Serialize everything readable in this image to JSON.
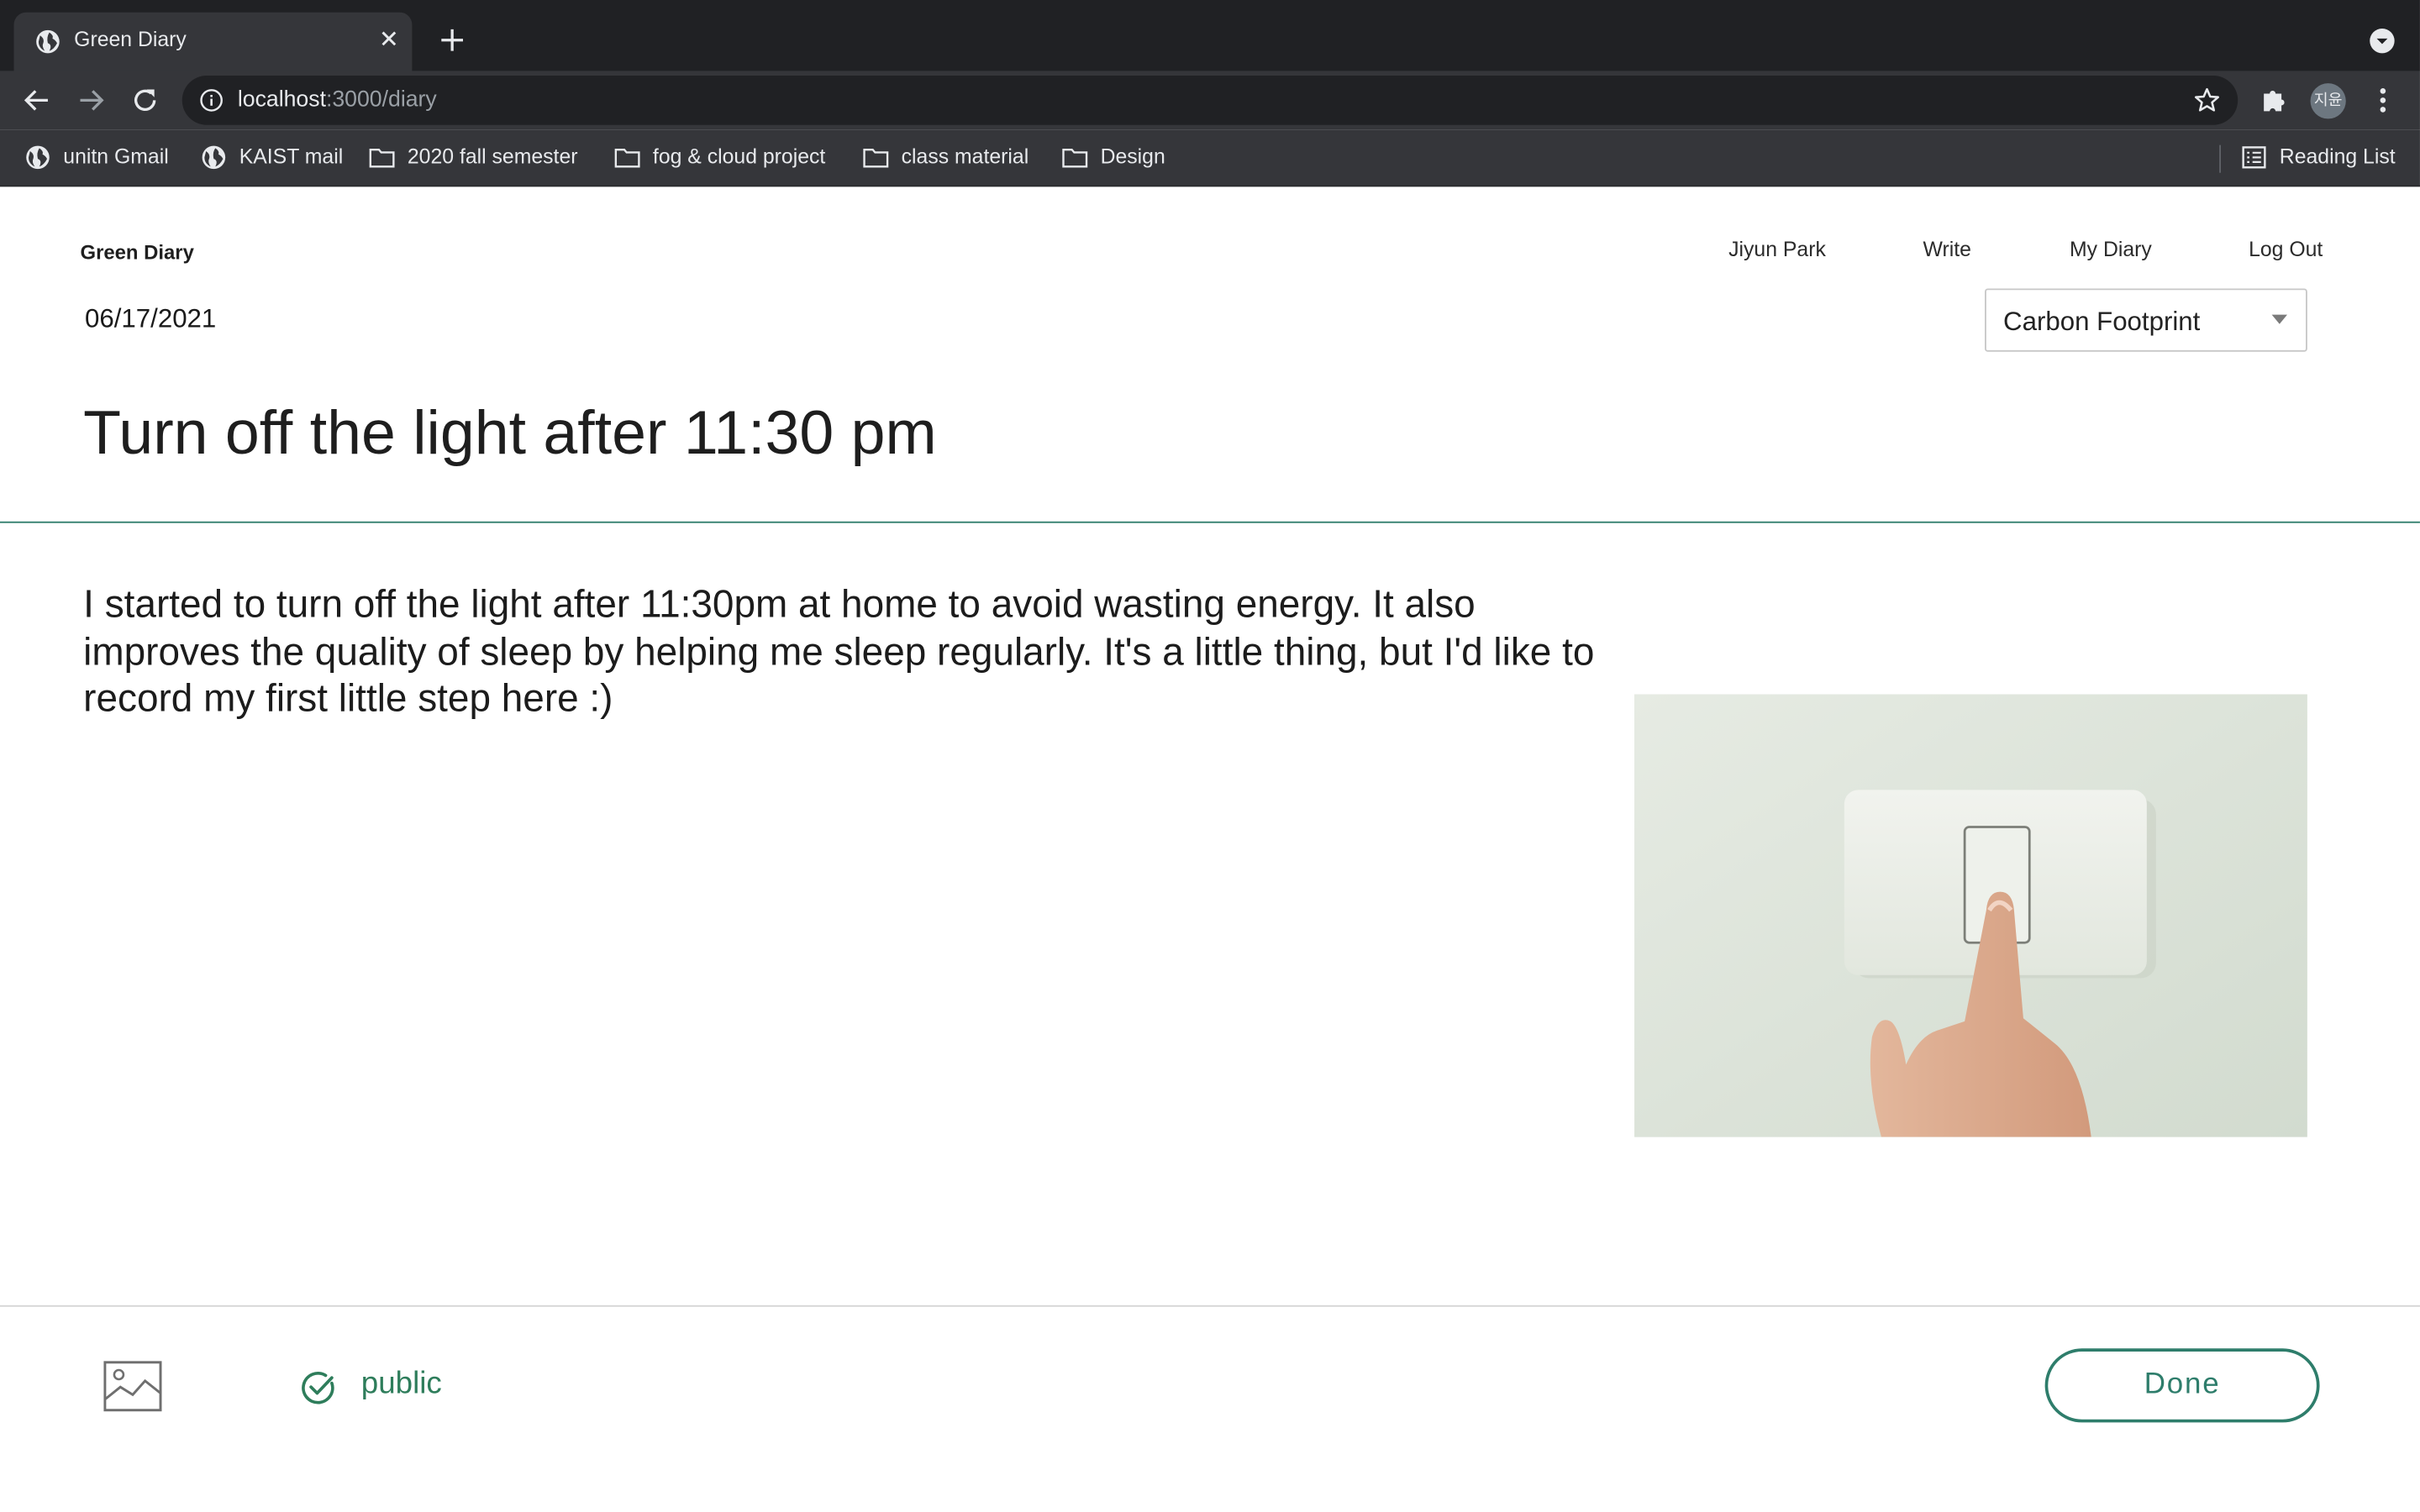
{
  "browser": {
    "tab_title": "Green Diary",
    "url_host": "localhost",
    "url_rest": ":3000/diary",
    "avatar_text": "지윤",
    "bookmarks": [
      "unitn Gmail",
      "KAIST mail",
      "2020 fall semester",
      "fog & cloud project",
      "class material",
      "Design"
    ],
    "reading_list": "Reading List"
  },
  "header": {
    "brand": "Green Diary",
    "nav": [
      "Jiyun Park",
      "Write",
      "My Diary",
      "Log Out"
    ]
  },
  "entry": {
    "date": "06/17/2021",
    "category": "Carbon Footprint",
    "title": "Turn off the light after 11:30 pm",
    "body": "I started to turn off the light after 11:30pm at home to avoid wasting energy. It also improves the quality of  sleep by helping me sleep regularly. It's a little thing, but I'd like to record my first little step here :)"
  },
  "footer": {
    "visibility": "public",
    "done_label": "Done"
  },
  "colors": {
    "accent": "#2e7d6b",
    "chrome_dark": "#202124",
    "chrome_toolbar": "#35363a"
  }
}
